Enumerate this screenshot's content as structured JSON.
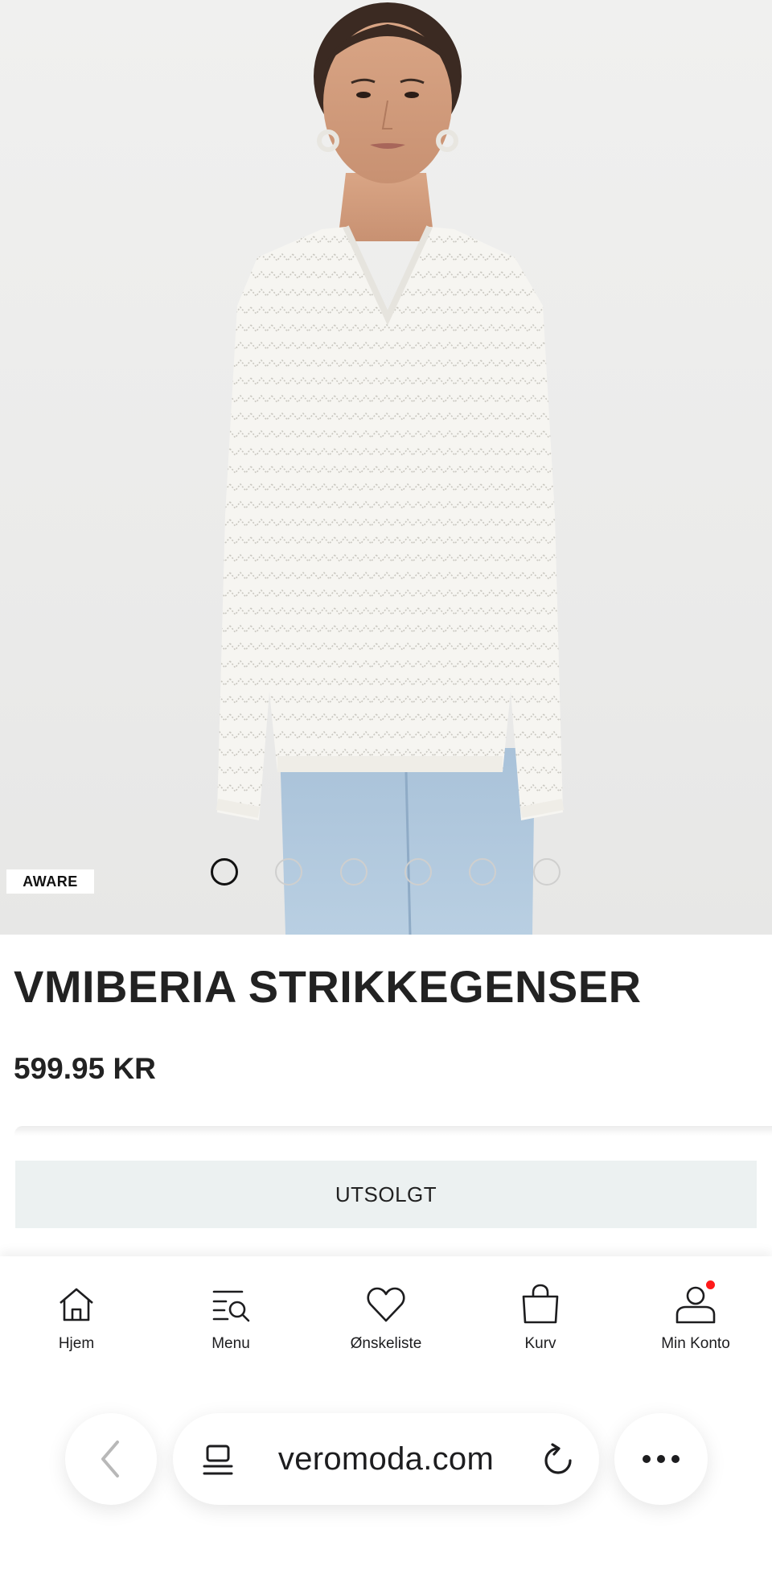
{
  "product": {
    "badge": "AWARE",
    "title": "VMIBERIA STRIKKEGENSER",
    "price": "599.95 KR",
    "soldout_label": "UTSOLGT",
    "gallery": {
      "image_count": 6,
      "active_index": 0
    }
  },
  "bottom_nav": {
    "items": [
      {
        "label": "Hjem",
        "icon": "home-icon"
      },
      {
        "label": "Menu",
        "icon": "menu-search-icon"
      },
      {
        "label": "Ønskeliste",
        "icon": "heart-icon"
      },
      {
        "label": "Kurv",
        "icon": "bag-icon"
      },
      {
        "label": "Min Konto",
        "icon": "account-icon",
        "notification": true
      }
    ]
  },
  "browser": {
    "url": "veromoda.com",
    "back_icon": "chevron-left-icon",
    "tabs_icon": "tabs-icon",
    "reload_icon": "reload-icon",
    "more_icon": "more-icon"
  },
  "colors": {
    "notification": "#ff1a1a",
    "soldout_bg": "#ecf1f1",
    "text": "#1d1d1f"
  }
}
